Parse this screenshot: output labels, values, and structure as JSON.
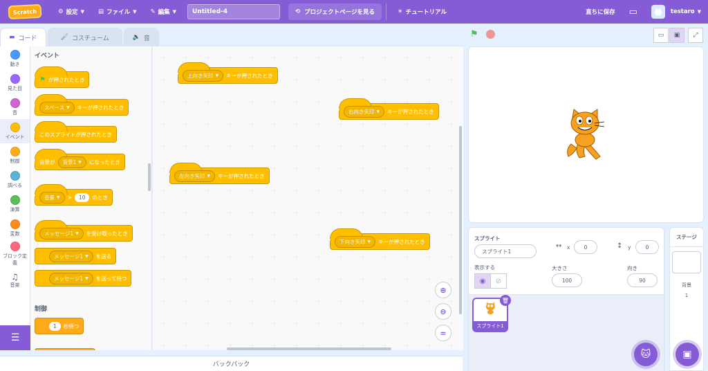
{
  "menubar": {
    "logo": "Scratch",
    "settings": "設定",
    "file": "ファイル",
    "edit": "編集",
    "project_title": "Untitled-4",
    "project_page": "プロジェクトページを見る",
    "tutorials": "チュートリアル",
    "save_now": "直ちに保存",
    "username": "testaro"
  },
  "tabs": {
    "code": "コード",
    "costumes": "コスチューム",
    "sounds": "音"
  },
  "categories": [
    {
      "label": "動き",
      "color": "#4c97ff"
    },
    {
      "label": "見た目",
      "color": "#9966ff"
    },
    {
      "label": "音",
      "color": "#cf63cf"
    },
    {
      "label": "イベント",
      "color": "#ffbf00"
    },
    {
      "label": "制御",
      "color": "#ffab19"
    },
    {
      "label": "調べる",
      "color": "#5cb1d6"
    },
    {
      "label": "演算",
      "color": "#59c059"
    },
    {
      "label": "変数",
      "color": "#ff8c1a"
    },
    {
      "label": "ブロック定義",
      "color": "#ff6680"
    },
    {
      "label": "音楽",
      "color": "#0fbd8c"
    }
  ],
  "palette": {
    "events_title": "イベント",
    "control_title": "制御",
    "flag_clicked": "が押されたとき",
    "space_key": "スペース",
    "key_pressed": "キーが押されたとき",
    "sprite_clicked": "このスプライトが押されたとき",
    "backdrop_prefix": "背景が",
    "backdrop_value": "背景1",
    "backdrop_suffix": "になったとき",
    "loudness": "音量",
    "gt": ">",
    "loudness_value": "10",
    "loudness_suffix": "のとき",
    "message_value": "メッセージ1",
    "receive_suffix": "を受け取ったとき",
    "broadcast_suffix": "を送る",
    "broadcast_wait_suffix": "を送って待つ",
    "wait_value": "1",
    "wait_suffix": "秒待つ"
  },
  "scripts": {
    "up": "上向き矢印",
    "right": "右向き矢印",
    "left": "左向き矢印",
    "down": "下向き矢印",
    "key_pressed": "キーが押されたとき"
  },
  "backpack": "バックパック",
  "sprite_info": {
    "sprite_label": "スプライト",
    "sprite_name": "スプライト1",
    "x_label": "x",
    "x_value": "0",
    "y_label": "y",
    "y_value": "0",
    "show_label": "表示する",
    "size_label": "大きさ",
    "size_value": "100",
    "direction_label": "向き",
    "direction_value": "90",
    "thumb_name": "スプライト1"
  },
  "stage_pane": {
    "title": "ステージ",
    "backdrops_label": "背景",
    "backdrops_count": "1"
  },
  "colors": {
    "accent": "#855cd6",
    "events": "#ffbf00",
    "control": "#ffab19"
  }
}
